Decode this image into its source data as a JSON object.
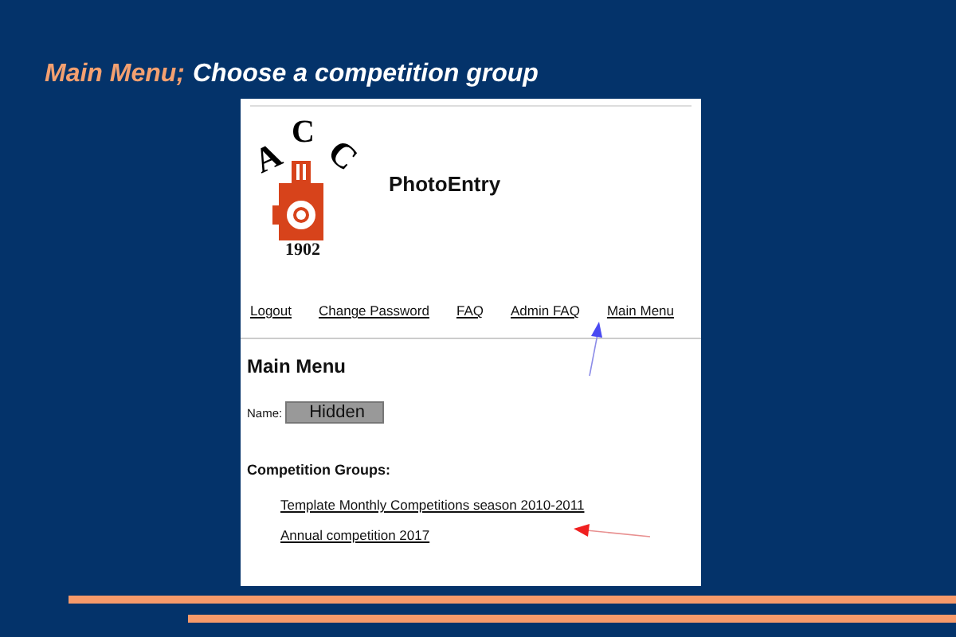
{
  "slide": {
    "title_lead": "Main Menu;",
    "title": "Choose a competition group"
  },
  "page": {
    "logo": {
      "letters": [
        "A",
        "C",
        "C"
      ],
      "year": "1902"
    },
    "site_name": "PhotoEntry",
    "nav": [
      "Logout",
      "Change Password",
      "FAQ",
      "Admin FAQ",
      "Main Menu"
    ],
    "heading": "Main Menu",
    "name_label": "Name:",
    "name_value": "Hidden",
    "groups_heading": "Competition Groups:",
    "groups": [
      "Template Monthly Competitions season 2010-2011",
      "Annual competition 2017"
    ]
  }
}
